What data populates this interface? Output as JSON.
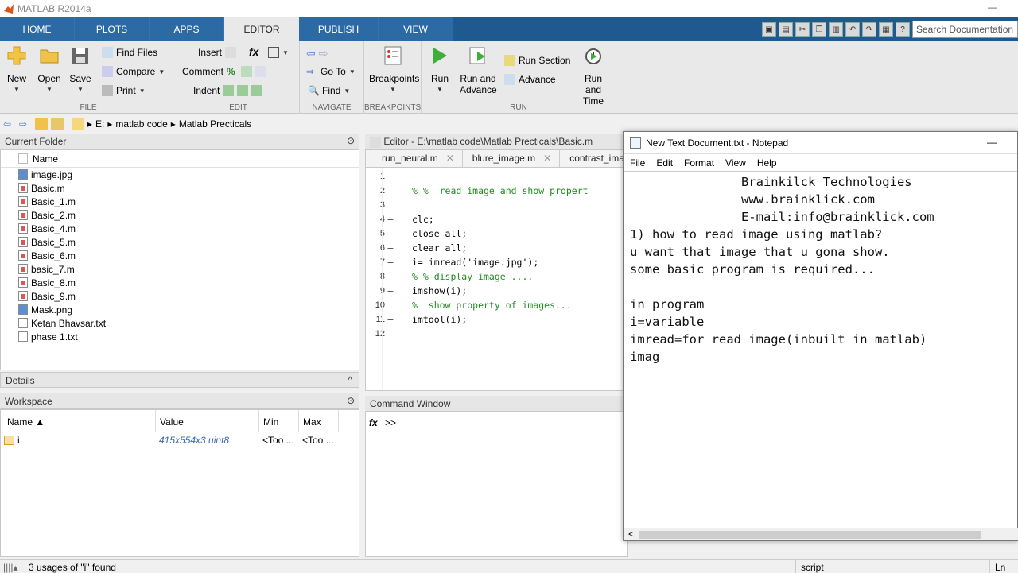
{
  "window": {
    "title": "MATLAB R2014a",
    "minimize": "—"
  },
  "tabs": [
    {
      "label": "HOME"
    },
    {
      "label": "PLOTS"
    },
    {
      "label": "APPS"
    },
    {
      "label": "EDITOR"
    },
    {
      "label": "PUBLISH"
    },
    {
      "label": "VIEW"
    }
  ],
  "search": {
    "placeholder": "Search Documentation"
  },
  "ribbon": {
    "file": {
      "label": "FILE",
      "new": "New",
      "open": "Open",
      "save": "Save",
      "find_files": "Find Files",
      "compare": "Compare",
      "print": "Print"
    },
    "edit": {
      "label": "EDIT",
      "insert": "Insert",
      "comment": "Comment",
      "indent": "Indent",
      "fx": "fx"
    },
    "navigate": {
      "label": "NAVIGATE",
      "goto": "Go To",
      "find": "Find"
    },
    "breakpoints": {
      "label": "BREAKPOINTS",
      "breakpoints": "Breakpoints"
    },
    "run": {
      "label": "RUN",
      "run": "Run",
      "run_advance_1": "Run and",
      "run_advance_2": "Advance",
      "run_section": "Run Section",
      "advance": "Advance",
      "run_time_1": "Run and",
      "run_time_2": "Time"
    }
  },
  "address": {
    "drive": "E:",
    "folder1": "matlab code",
    "folder2": "Matlab Precticals"
  },
  "current_folder": {
    "title": "Current Folder",
    "col_name": "Name",
    "files": [
      "image.jpg",
      "Basic.m",
      "Basic_1.m",
      "Basic_2.m",
      "Basic_4.m",
      "Basic_5.m",
      "Basic_6.m",
      "basic_7.m",
      "Basic_8.m",
      "Basic_9.m",
      "Mask.png",
      "Ketan Bhavsar.txt",
      "phase 1.txt"
    ]
  },
  "details": {
    "title": "Details"
  },
  "workspace": {
    "title": "Workspace",
    "columns": [
      "Name ▲",
      "Value",
      "Min",
      "Max"
    ],
    "rows": [
      {
        "name": "i",
        "value": "415x554x3 uint8",
        "min": "<Too ...",
        "max": "<Too ..."
      }
    ]
  },
  "editor": {
    "title": "Editor - E:\\matlab code\\Matlab Precticals\\Basic.m",
    "tabs": [
      "run_neural.m",
      "blure_image.m",
      "contrast_ima"
    ],
    "lines": [
      {
        "n": "1",
        "dash": "",
        "text": ""
      },
      {
        "n": "2",
        "dash": "",
        "text": "% %  read image and show propert"
      },
      {
        "n": "3",
        "dash": "",
        "text": ""
      },
      {
        "n": "4",
        "dash": "–",
        "text": "clc;"
      },
      {
        "n": "5",
        "dash": "–",
        "text": "close all;"
      },
      {
        "n": "6",
        "dash": "–",
        "text": "clear all;"
      },
      {
        "n": "7",
        "dash": "–",
        "text": "i= imread('image.jpg');"
      },
      {
        "n": "8",
        "dash": "",
        "text": "% % display image ...."
      },
      {
        "n": "9",
        "dash": "–",
        "text": "imshow(i);"
      },
      {
        "n": "10",
        "dash": "",
        "text": "%  show property of images..."
      },
      {
        "n": "11",
        "dash": "–",
        "text": "imtool(i);"
      },
      {
        "n": "12",
        "dash": "",
        "text": ""
      }
    ]
  },
  "command_window": {
    "title": "Command Window",
    "prompt": ">>",
    "fx": "fx"
  },
  "notepad": {
    "title": "New Text Document.txt - Notepad",
    "menu": [
      "File",
      "Edit",
      "Format",
      "View",
      "Help"
    ],
    "text": "               Brainkilck Technologies\n               www.brainklick.com\n               E-mail:info@brainklick.com\n1) how to read image using matlab?\nu want that image that u gona show.\nsome basic program is required...\n\nin program\ni=variable\nimread=for read image(inbuilt in matlab)\nimag",
    "scroll_left": "<"
  },
  "status": {
    "left": "3 usages of \"i\" found",
    "mid": "script",
    "right": "Ln"
  },
  "colors": {
    "tabstrip": "#1e5a8f",
    "ribbon": "#e9e9e9",
    "comment": "#228b22",
    "string": "#a020f0"
  }
}
